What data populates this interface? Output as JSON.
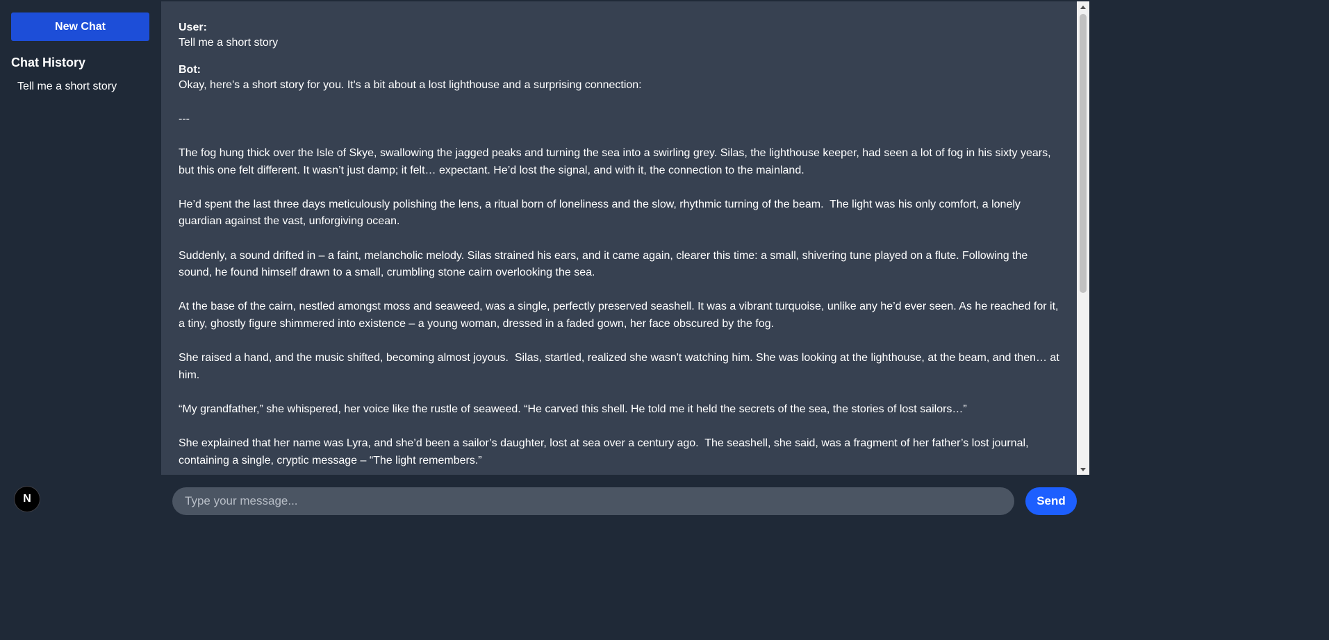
{
  "sidebar": {
    "new_chat_label": "New Chat",
    "history_title": "Chat History",
    "history_items": [
      {
        "label": "Tell me a short story"
      }
    ],
    "logo_letter": "N"
  },
  "conversation": {
    "user": {
      "role": "User:",
      "text": "Tell me a short story"
    },
    "bot": {
      "role": "Bot:",
      "text": "Okay, here's a short story for you. It's a bit about a lost lighthouse and a surprising connection:\n\n---\n\nThe fog hung thick over the Isle of Skye, swallowing the jagged peaks and turning the sea into a swirling grey. Silas, the lighthouse keeper, had seen a lot of fog in his sixty years, but this one felt different. It wasn’t just damp; it felt… expectant. He’d lost the signal, and with it, the connection to the mainland.\n\nHe’d spent the last three days meticulously polishing the lens, a ritual born of loneliness and the slow, rhythmic turning of the beam.  The light was his only comfort, a lonely guardian against the vast, unforgiving ocean.\n\nSuddenly, a sound drifted in – a faint, melancholic melody. Silas strained his ears, and it came again, clearer this time: a small, shivering tune played on a flute. Following the sound, he found himself drawn to a small, crumbling stone cairn overlooking the sea.\n\nAt the base of the cairn, nestled amongst moss and seaweed, was a single, perfectly preserved seashell. It was a vibrant turquoise, unlike any he’d ever seen. As he reached for it, a tiny, ghostly figure shimmered into existence – a young woman, dressed in a faded gown, her face obscured by the fog.\n\nShe raised a hand, and the music shifted, becoming almost joyous.  Silas, startled, realized she wasn't watching him. She was looking at the lighthouse, at the beam, and then… at him.\n\n“My grandfather,” she whispered, her voice like the rustle of seaweed. “He carved this shell. He told me it held the secrets of the sea, the stories of lost sailors…”\n\nShe explained that her name was Lyra, and she’d been a sailor’s daughter, lost at sea over a century ago.  The seashell, she said, was a fragment of her father’s lost journal, containing a single, cryptic message – “The light remembers.”"
    }
  },
  "composer": {
    "placeholder": "Type your message...",
    "value": "",
    "send_label": "Send"
  },
  "colors": {
    "sidebar_bg": "#1f2937",
    "chat_bg": "#374151",
    "primary": "#1d4ed8",
    "send": "#1d5ffe",
    "input_bg": "#4b5563"
  },
  "icons": {
    "logo": "nextjs-logo-icon",
    "scroll_up": "scroll-up-arrow-icon",
    "scroll_down": "scroll-down-arrow-icon"
  }
}
